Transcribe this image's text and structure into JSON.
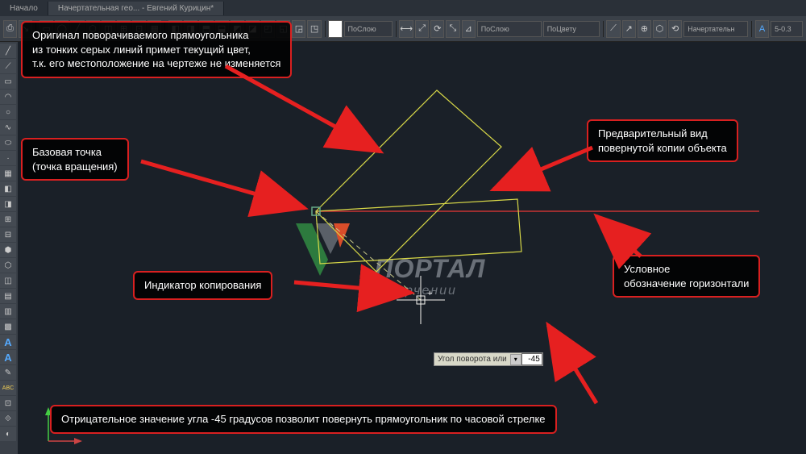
{
  "tabs": {
    "start": "Начало",
    "doc": "Начертательная гео... - Евгений Курицин*"
  },
  "ribbon": {
    "layer": "ПоСлою",
    "bylayer2": "ПоСлою",
    "bycolor": "ПоЦвету",
    "style_name": "Начертательн",
    "dim": "5-0.3"
  },
  "sidebar": {
    "letterA1": "A",
    "letterA2": "A",
    "abc": "ABC"
  },
  "callouts": {
    "c1l1": "Оригинал поворачиваемого прямоугольника",
    "c1l2": "из тонких серых линий примет текущий цвет,",
    "c1l3": "т.к. его местоположение на чертеже не изменяется",
    "c2l1": "Базовая точка",
    "c2l2": "(точка вращения)",
    "c3l1": "Предварительный вид",
    "c3l2": "повернутой копии объекта",
    "c4": "Индикатор копирования",
    "c5l1": "Условное",
    "c5l2": "обозначение горизонтали",
    "c6": "Отрицательное значение угла -45 градусов позволит повернуть прямоугольник по часовой стрелке"
  },
  "input": {
    "label": "Угол поворота или",
    "value": "-45"
  },
  "watermark": {
    "line1": "ПОРТАЛ",
    "line2": "о черчении"
  }
}
